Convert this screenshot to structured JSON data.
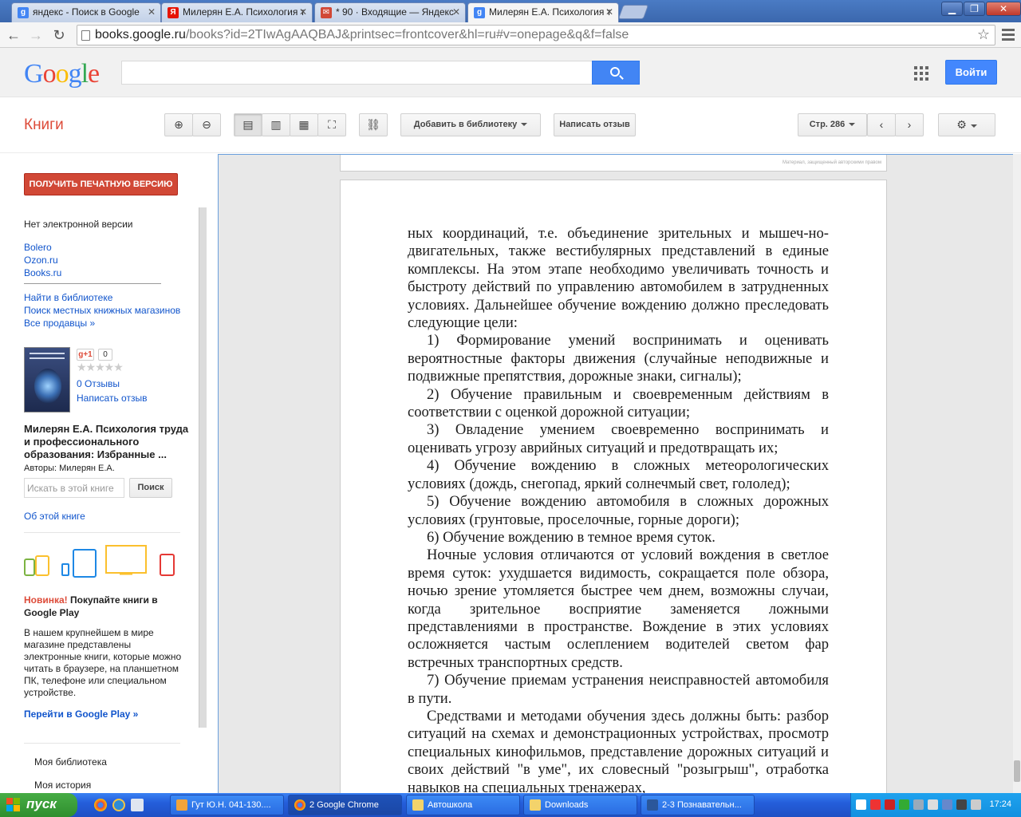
{
  "browser": {
    "tabs": [
      {
        "label": "яндекс - Поиск в Google",
        "icon": "google-favicon",
        "color": "#4285f4"
      },
      {
        "label": "Милерян Е.А. Психология т",
        "icon": "yandex-favicon",
        "color": "#e61400"
      },
      {
        "label": "* 90 · Входящие — Яндекс",
        "icon": "yandex-mail-favicon",
        "color": "#d14836"
      },
      {
        "label": "Милерян Е.А. Психология т",
        "icon": "google-books-favicon",
        "color": "#4285f4"
      }
    ],
    "url_host": "books.google.ru",
    "url_path": "/books?id=2TIwAgAAQBAJ&printsec=frontcover&hl=ru#v=onepage&q&f=false"
  },
  "google_header": {
    "logo": "Google",
    "search_placeholder": "",
    "signin_label": "Войти"
  },
  "books_toolbar": {
    "title": "Книги",
    "add_library_label": "Добавить в библиотеку",
    "write_review_label": "Написать отзыв",
    "page_label": "Стр. 286"
  },
  "sidebar": {
    "get_print_label": "ПОЛУЧИТЬ ПЕЧАТНУЮ ВЕРСИЮ",
    "no_ebook_text": "Нет электронной версии",
    "sellers": [
      "Bolero",
      "Ozon.ru",
      "Books.ru"
    ],
    "library_links": [
      "Найти в библиотеке",
      "Поиск местных книжных магазинов",
      "Все продавцы »"
    ],
    "gplus_label": "g+1",
    "gplus_count": "0",
    "reviews_count_label": "0 Отзывы",
    "write_review_label": "Написать отзыв",
    "book_title": "Милерян Е.А. Психология труда и профессионального образования: Избранные ...",
    "authors": "Авторы: Милерян Е.А.",
    "in_book_search_placeholder": "Искать в этой книге",
    "in_book_search_button": "Поиск",
    "about_book_link": "Об этой книге",
    "play_new_label": "Новинка!",
    "play_title": "Покупайте книги в Google Play",
    "play_description": "В нашем крупнейшем в мире магазине представлены электронные книги, которые можно читать в браузере, на планшетном ПК, телефоне или специальном устройстве.",
    "play_link": "Перейти в Google Play »",
    "my_library": "Моя библиотека",
    "my_history": "Моя история"
  },
  "viewer": {
    "prev_page_watermark": "Материал, защищенный авторскими правом",
    "paragraphs": [
      {
        "indent": false,
        "text": "ных координаций, т.е. объединение зрительных и мышеч-но-двигательных, также вестибулярных представлений в единые комплексы. На этом этапе необходимо увеличивать точность и быстроту действий по управлению автомобилем в затрудненных условиях. Дальнейшее обучение вождению должно преследовать следующие цели:"
      },
      {
        "indent": true,
        "text": "1) Формирование умений воспринимать и оценивать вероятностные факторы движения (случайные неподвижные и подвижные препятствия, дорожные знаки, сигналы);"
      },
      {
        "indent": true,
        "text": "2) Обучение правильным и своевременным действиям в соответствии с оценкой дорожной ситуации;"
      },
      {
        "indent": true,
        "text": "3) Овладение умением своевременно воспринимать и оценивать угрозу аврийных ситуаций и предотвращать их;"
      },
      {
        "indent": true,
        "text": "4) Обучение вождению в сложных метеорологических условиях (дождь, снегопад, яркий солнечмый свет, гололед);"
      },
      {
        "indent": true,
        "text": "5) Обучение вождению автомобиля в сложных дорожных условиях (грунтовые, проселочные, горные дороги);"
      },
      {
        "indent": true,
        "text": "6) Обучение вождению в темное время суток."
      },
      {
        "indent": true,
        "text": "Ночные условия отличаются от условий вождения в светлое время суток: ухудшается видимость, сокращается поле обзора, ночью зрение утомляется быстрее чем днем, возможны случаи, когда зрительное восприятие заменяется ложными представлениями в пространстве. Вождение в этих условиях осложняется частым ослеплением водителей светом фар встречных транспортных средств."
      },
      {
        "indent": true,
        "text": "7) Обучение приемам устранения неисправностей автомобиля в пути."
      },
      {
        "indent": true,
        "text": "Средствами и методами обучения здесь должны быть: разбор ситуаций на схемах и демонстрационных устройствах, просмотр специальных кинофильмов, представление дорожных ситуаций и своих действий \"в уме\", их словесный \"розыгрыш\", отработка навыков на специальных тренажерах,"
      }
    ]
  },
  "taskbar": {
    "start_label": "пуск",
    "tasks": [
      {
        "label": "Гут Ю.Н. 041-130....",
        "color": "#f2a43a"
      },
      {
        "label": "2 Google Chrome",
        "color": "#e8e8e8"
      },
      {
        "label": "Автошкола",
        "color": "#f3d36b"
      },
      {
        "label": "Downloads",
        "color": "#f3d36b"
      },
      {
        "label": "2-3 Познавательн...",
        "color": "#2b579a"
      }
    ],
    "clock": "17:24"
  }
}
